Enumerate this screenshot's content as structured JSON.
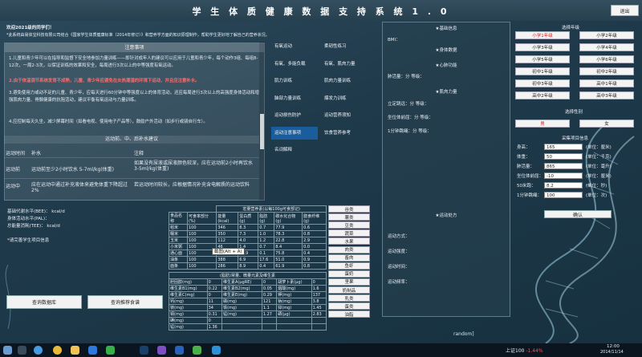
{
  "app": {
    "title": "学 生 体 质 健 康 数 据 支 持 系 统 1 . 0",
    "exit_label": "退出"
  },
  "intro": {
    "heading": "欢迎2021级的同学们！",
    "body": "*此系统由易体宝科技有限公司结合《国家学生体质健康标准（2014年修订）》和营养学方面的知识原理制作，帮助学生更好地了解自己的营养状况。"
  },
  "notice": {
    "title": "注意事项",
    "p1": "1.儿童和青少年可以在指导和监督下安全地参加力量训练——即针对成年人的建议可以应用于儿童和青少年，每个动作3组、每组8-12次，一周2-3次，以保证训练的效果和安全，每周进行3次以上的中等强度有氧运动。",
    "p2": "2.由于体温调节系统发育不成熟，儿童、青少年应避免在炎热潮湿的环境下运动，并且应注意补水。",
    "p3": "3.避免使用力或动不足的儿童、青少年，应每天进行60分钟中等强度以上的体育活动，还应每周进行3次以上的高强度身体活动和增强肌肉力量、骨骼健康的抗阻活动，建议平衡有氧运动与力量训练。",
    "p4": "4.应控制每天久坐，减少屏幕时间（如看电视、使用电子产品等），鼓励户外活动（如步行或骑自行车）。",
    "exercise_heading": "运动前、中、后补水建议",
    "cols": [
      "运动时间",
      "补水",
      "注释"
    ],
    "rows": [
      {
        "time": "运动前",
        "water": "运动前至少2小时饮水 5-7ml/kg(体重)",
        "note": "如果没有尿液或尿液颜色较深，应在运动前2小时再饮水 3-5ml/kg(体重)"
      },
      {
        "time": "运动中",
        "water": "应在运动中通过补充液体来避免体重下降超过2%",
        "note": "若运动时间较长，应根据情况补充含电解质的运动饮料"
      }
    ]
  },
  "menu": {
    "items": [
      "有氧运动",
      "柔韧性练习",
      "有氧、多能负载",
      "有氧、肌肉力量",
      "肌力训练",
      "肌肉力量训练",
      "脑部力量训练",
      "爆发力训练",
      "运动损伤防护",
      "运动营养须知",
      "运动注意事项",
      "饮食营养参考",
      "名词解释",
      ""
    ],
    "active_index": 10
  },
  "report": {
    "basic_title": "★基础信息",
    "bmi_label": "BMI：",
    "physical_title": "★身体数据",
    "cardio_title": "★心肺功能",
    "pulse_label": "肺活量：分  等级：",
    "strength_title": "★肌肉力量",
    "jump_label": "立定跳远：分  等级：",
    "flex_label": "坐位体前屈：分  等级：",
    "run_label": "1分钟跳绳：分  等级：",
    "suggest_title": "★运动处方",
    "s1": "运动方式：",
    "s2": "运动强度：",
    "s3": "运动时间：",
    "s4": "运动频率："
  },
  "right": {
    "grade_title": "选择年级",
    "grades": [
      "小学1年级",
      "小学2年级",
      "小学3年级",
      "小学4年级",
      "小学5年级",
      "小学6年级",
      "初中1年级",
      "初中2年级",
      "初中3年级",
      "高中1年级",
      "高中2年级",
      "高中3年级"
    ],
    "selected_grade": 0,
    "gender_title": "选择性别",
    "genders": [
      "男",
      "女"
    ],
    "selected_gender": 0,
    "data_title": "采集项目信息",
    "fields": [
      {
        "label": "身高：",
        "value": "165",
        "unit": "(单位：厘米)"
      },
      {
        "label": "体重：",
        "value": "50",
        "unit": "(单位：千克)"
      },
      {
        "label": "肺活量：",
        "value": "865",
        "unit": "(单位：毫升)"
      },
      {
        "label": "坐位体前屈：",
        "value": "-10",
        "unit": "(单位：厘米)"
      },
      {
        "label": "50米跑：",
        "value": "8.2",
        "unit": "(单位：秒)"
      },
      {
        "label": "1分钟跳绳：",
        "value": "100",
        "unit": "(单位：次)"
      }
    ],
    "confirm_label": "确认"
  },
  "energy": {
    "bmr_label": "基础代谢水平(BEE)：  kcal/d",
    "pal_label": "身体活动水平(PAL)：",
    "tee_label": "总能量消耗(TEE)：  kcal/d",
    "student_label": "*请完善学生项目信息",
    "btn_data": "查询数据库",
    "btn_more": "查询推荐食谱"
  },
  "food_table": {
    "caption": "宏量营养素(以每100g可食部记)",
    "headers": [
      "食品名称",
      "可食率部分(%)",
      "能量(kcal)",
      "蛋白质(g)",
      "脂肪(g)",
      "碳水化合物(g)",
      "膳食纤维(g)"
    ],
    "rows": [
      [
        "稻米",
        "100",
        "346",
        "8.3",
        "0.7",
        "77.9",
        "0.6"
      ],
      [
        "糯米",
        "100",
        "350",
        "7.3",
        "1.0",
        "78.3",
        "0.8"
      ],
      [
        "玉米",
        "100",
        "112",
        "4.0",
        "1.2",
        "22.8",
        "2.9"
      ],
      [
        "小米粥",
        "100",
        "46",
        "1.4",
        "0.7",
        "8.4",
        "0.0"
      ],
      [
        "通心面",
        "100",
        "351",
        "11.9",
        "0.1",
        "75.8",
        "0.4"
      ],
      [
        "油条",
        "100",
        "388",
        "6.9",
        "17.6",
        "51.0",
        "0.9"
      ],
      [
        "面条",
        "100",
        "286",
        "8.9",
        "0.4",
        "61.9",
        "0.8"
      ]
    ],
    "tooltip": "截图(Alt + A)"
  },
  "food_categories": [
    "谷类",
    "薯类",
    "豆类",
    "蔬菜",
    "水果",
    "肉类",
    "畜肉",
    "鱼虾",
    "蛋奶",
    "坚果",
    "奶制品",
    "乳类",
    "蛋类",
    "油脂"
  ],
  "mineral_table": {
    "caption": "(脂肪)常量、微量元素及维生素",
    "rows": [
      [
        "胆固醇(mg)",
        "0",
        "维生素A(μgRE)",
        "0",
        "胡萝卜素(μg)",
        "0"
      ],
      [
        "维生素B1(mg)",
        "0.22",
        "维生素B2(mg)",
        "0.05",
        "烟酸(mg)",
        "1.6"
      ],
      [
        "维生素C(mg)",
        "0",
        "维生素E(mg)",
        "0.29",
        "钾(mg)",
        "137"
      ],
      [
        "钙(mg)",
        "11",
        "磷(mg)",
        "121",
        "钠(mg)",
        "3.8"
      ],
      [
        "镁(mg)",
        "34",
        "铁(mg)",
        "1.1",
        "锌(mg)",
        "1.45"
      ],
      [
        "铜(mg)",
        "0.31",
        "锰(mg)",
        "1.27",
        "硒(μg)",
        "2.83"
      ],
      [
        "碘(mg)",
        "0",
        "",
        "",
        "",
        ""
      ],
      [
        "锰(mg)",
        "1.36",
        "",
        "",
        "",
        ""
      ]
    ]
  },
  "watermark": "random]",
  "taskbar": {
    "stock": "上证100",
    "stock_change": "-1.44%",
    "time": "12:00",
    "date": "2014/11/14"
  },
  "colors": {
    "accent": "#1a5d9c",
    "warning": "#ff6b6b",
    "selected": "#e02020"
  }
}
